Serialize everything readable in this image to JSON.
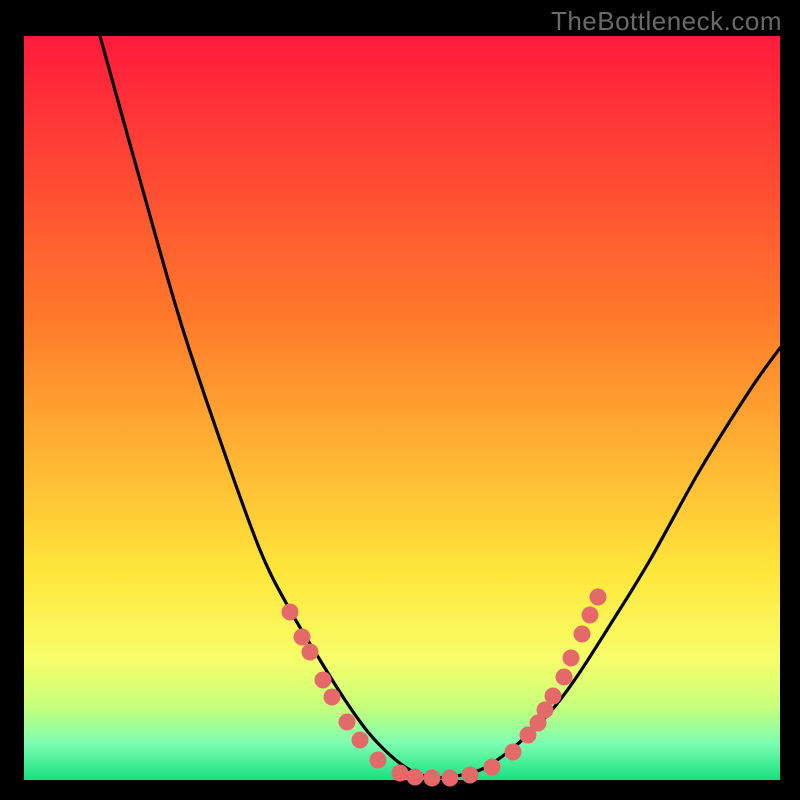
{
  "watermark": "TheBottleneck.com",
  "colors": {
    "black": "#000000",
    "gradient_top": "#ff1a3c",
    "gradient_mid1": "#ff7a2a",
    "gradient_mid2": "#ffe63a",
    "gradient_band1": "#f6ff6a",
    "gradient_band2": "#c8ff7a",
    "gradient_band3": "#7dffb0",
    "gradient_bottom": "#18e07f",
    "curve": "#000000",
    "dot": "#e46a6a"
  },
  "chart_data": {
    "type": "line",
    "title": "",
    "xlabel": "",
    "ylabel": "",
    "xlim": [
      24,
      780
    ],
    "ylim": [
      36,
      780
    ],
    "series": [
      {
        "name": "bottleneck-curve",
        "x": [
          100,
          140,
          180,
          220,
          260,
          290,
          320,
          345,
          368,
          390,
          410,
          430,
          450,
          480,
          500,
          520,
          543,
          560,
          580,
          610,
          650,
          700,
          750,
          780
        ],
        "values": [
          36,
          180,
          320,
          440,
          550,
          610,
          660,
          700,
          732,
          755,
          770,
          777,
          777,
          770,
          758,
          742,
          720,
          700,
          672,
          625,
          560,
          470,
          390,
          348
        ]
      }
    ],
    "left_dots": [
      {
        "x": 290,
        "y": 612
      },
      {
        "x": 302,
        "y": 637
      },
      {
        "x": 310,
        "y": 652
      },
      {
        "x": 323,
        "y": 680
      },
      {
        "x": 332,
        "y": 697
      },
      {
        "x": 347,
        "y": 722
      },
      {
        "x": 360,
        "y": 740
      },
      {
        "x": 378,
        "y": 760
      }
    ],
    "bottom_dots": [
      {
        "x": 400,
        "y": 773
      },
      {
        "x": 415,
        "y": 777
      },
      {
        "x": 432,
        "y": 778
      },
      {
        "x": 450,
        "y": 778
      },
      {
        "x": 470,
        "y": 775
      },
      {
        "x": 492,
        "y": 767
      }
    ],
    "right_dots": [
      {
        "x": 513,
        "y": 752
      },
      {
        "x": 528,
        "y": 735
      },
      {
        "x": 538,
        "y": 723
      },
      {
        "x": 545,
        "y": 710
      },
      {
        "x": 553,
        "y": 696
      },
      {
        "x": 564,
        "y": 677
      },
      {
        "x": 571,
        "y": 658
      },
      {
        "x": 582,
        "y": 634
      },
      {
        "x": 590,
        "y": 615
      },
      {
        "x": 598,
        "y": 597
      }
    ]
  }
}
